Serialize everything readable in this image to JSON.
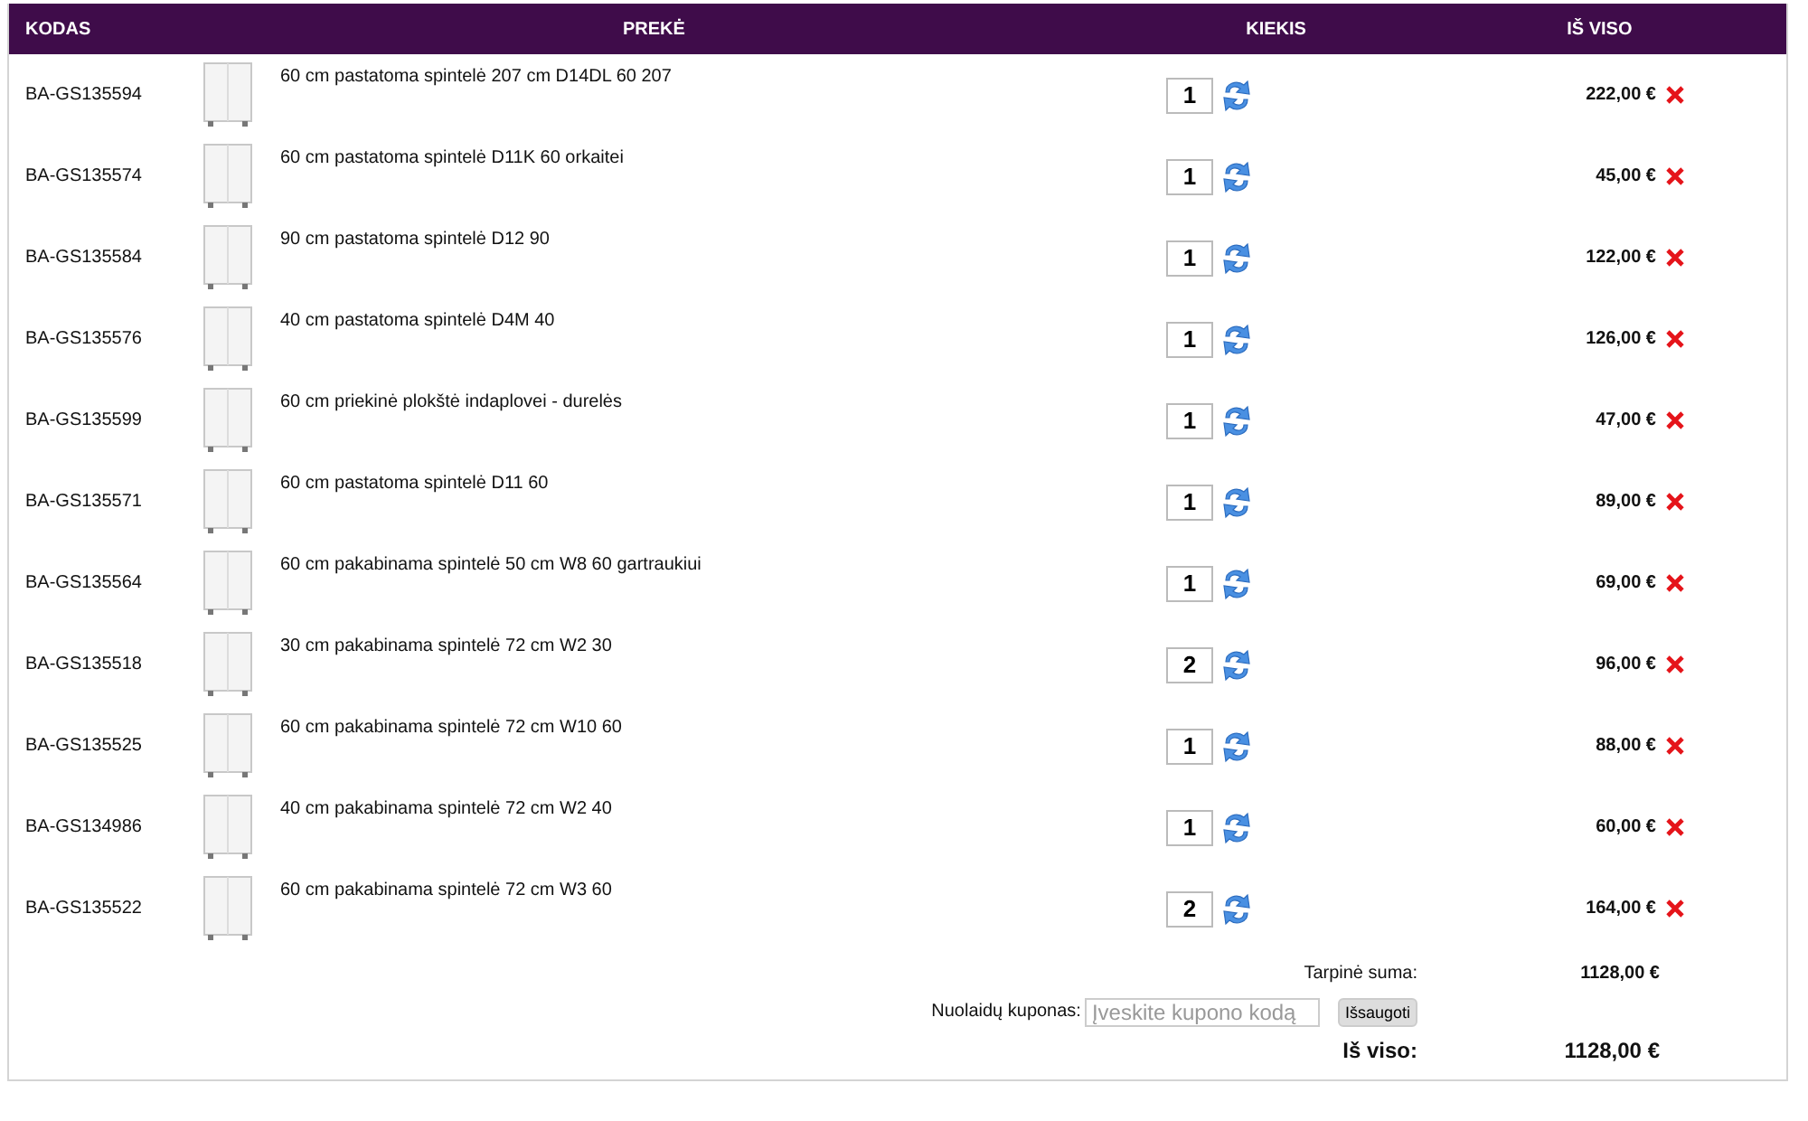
{
  "table": {
    "columns": [
      "KODAS",
      "PREKĖ",
      "KIEKIS",
      "IŠ VISO"
    ],
    "rows": [
      {
        "code": "BA-GS135594",
        "name": "60 cm pastatoma spintelė 207 cm D14DL 60 207",
        "quantity": "1",
        "total": "222,00 €"
      },
      {
        "code": "BA-GS135574",
        "name": "60 cm pastatoma spintelė D11K 60 orkaitei",
        "quantity": "1",
        "total": "45,00 €"
      },
      {
        "code": "BA-GS135584",
        "name": "90 cm pastatoma spintelė D12 90",
        "quantity": "1",
        "total": "122,00 €"
      },
      {
        "code": "BA-GS135576",
        "name": "40 cm pastatoma spintelė D4M 40",
        "quantity": "1",
        "total": "126,00 €"
      },
      {
        "code": "BA-GS135599",
        "name": "60 cm priekinė plokštė indaplovei - durelės",
        "quantity": "1",
        "total": "47,00 €"
      },
      {
        "code": "BA-GS135571",
        "name": "60 cm pastatoma spintelė D11 60",
        "quantity": "1",
        "total": "89,00 €"
      },
      {
        "code": "BA-GS135564",
        "name": "60 cm pakabinama spintelė 50 cm W8 60 gartraukiui",
        "quantity": "1",
        "total": "69,00 €"
      },
      {
        "code": "BA-GS135518",
        "name": "30 cm pakabinama spintelė 72 cm W2 30",
        "quantity": "2",
        "total": "96,00 €"
      },
      {
        "code": "BA-GS135525",
        "name": "60 cm pakabinama spintelė 72 cm W10 60",
        "quantity": "1",
        "total": "88,00 €"
      },
      {
        "code": "BA-GS134986",
        "name": "40 cm pakabinama spintelė 72 cm W2 40",
        "quantity": "1",
        "total": "60,00 €"
      },
      {
        "code": "BA-GS135522",
        "name": "60 cm pakabinama spintelė 72 cm W3 60",
        "quantity": "2",
        "total": "164,00 €"
      }
    ]
  },
  "summary": {
    "subtotal_label": "Tarpinė suma:",
    "subtotal": "1128,00 €",
    "coupon_label": "Nuolaidų kuponas:",
    "coupon_placeholder": "Įveskite kupono kodą",
    "coupon_button": "Išsaugoti",
    "total_label": "Iš viso:",
    "total": "1128,00 €"
  }
}
